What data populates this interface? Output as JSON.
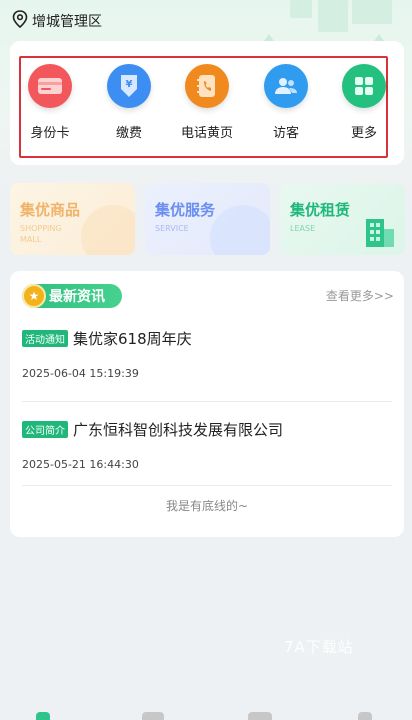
{
  "location": {
    "icon": "location-pin-icon",
    "name": "增城管理区"
  },
  "quick_actions": [
    {
      "label": "身份卡",
      "icon": "id-card-icon",
      "color": "#f2575c"
    },
    {
      "label": "缴费",
      "icon": "payment-icon",
      "color": "#3d8ef2"
    },
    {
      "label": "电话黄页",
      "icon": "phone-book-icon",
      "color": "#f18a1e"
    },
    {
      "label": "访客",
      "icon": "visitor-icon",
      "color": "#2f9cf0"
    },
    {
      "label": "更多",
      "icon": "grid-icon",
      "color": "#23c07f"
    }
  ],
  "services": [
    {
      "title": "集优商品",
      "subtitle": "SHOPPING MALL",
      "color": "#f0b36b"
    },
    {
      "title": "集优服务",
      "subtitle": "SERVICE",
      "color": "#6b8ff0"
    },
    {
      "title": "集优租赁",
      "subtitle": "LEASE",
      "color": "#1fb87a"
    }
  ],
  "news": {
    "title": "最新资讯",
    "more_label": "查看更多>>",
    "items": [
      {
        "tag": "活动通知",
        "headline": "集优家618周年庆",
        "time": "2025-06-04 15:19:39"
      },
      {
        "tag": "公司简介",
        "headline": "广东恒科智创科技发展有限公司",
        "time": "2025-05-21 16:44:30"
      }
    ],
    "end_text": "我是有底线的~"
  },
  "watermark": "7A下载站",
  "colors": {
    "accent": "#1fb87a",
    "highlight_frame": "#d8323a"
  }
}
